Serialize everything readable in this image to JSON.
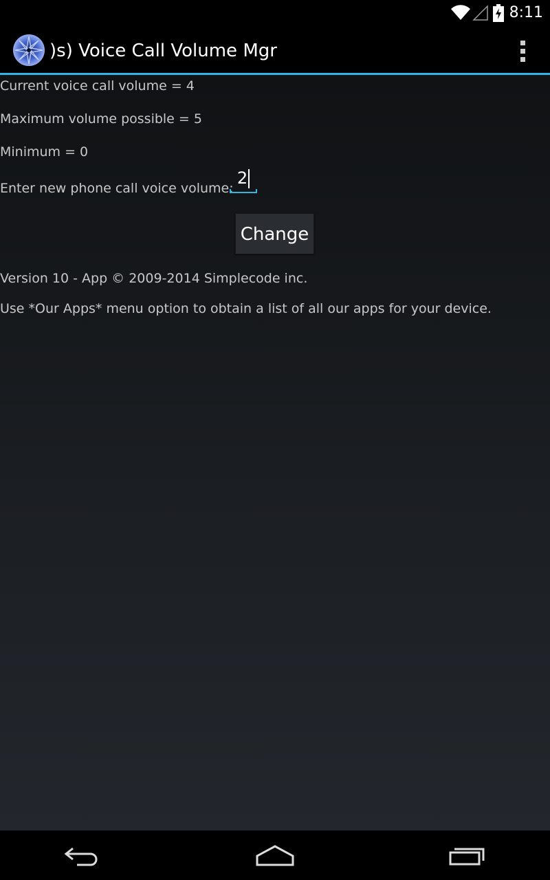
{
  "status_bar": {
    "time": "8:11",
    "icons": [
      "wifi-icon",
      "signal-icon",
      "battery-charging-icon"
    ]
  },
  "action_bar": {
    "title": ")s) Voice Call Volume Mgr",
    "app_icon": "flower-logo-icon",
    "menu_icon": "overflow-menu-icon"
  },
  "main": {
    "current_volume": "Current voice call volume = 4",
    "maximum_volume": "Maximum volume possible = 5",
    "minimum_volume": "Minimum = 0",
    "input_label": "Enter new phone call voice volume:",
    "input_value": "2",
    "change_button": "Change",
    "version": "Version 10 - App © 2009-2014 Simplecode inc.",
    "apps_hint": "Use *Our Apps* menu option to obtain a list of all our apps for your device."
  },
  "nav_bar": {
    "buttons": [
      "back-icon",
      "home-icon",
      "recent-apps-icon"
    ]
  },
  "colors": {
    "accent": "#33b5e5",
    "text": "#c8c8c8",
    "background": "#000000"
  }
}
